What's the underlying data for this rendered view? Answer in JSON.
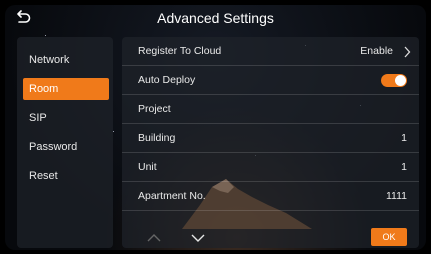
{
  "header": {
    "title": "Advanced Settings"
  },
  "sidebar": {
    "items": [
      {
        "label": "Network",
        "active": false
      },
      {
        "label": "Room",
        "active": true
      },
      {
        "label": "SIP",
        "active": false
      },
      {
        "label": "Password",
        "active": false
      },
      {
        "label": "Reset",
        "active": false
      }
    ]
  },
  "settings": {
    "register_to_cloud": {
      "label": "Register To Cloud",
      "value": "Enable"
    },
    "auto_deploy": {
      "label": "Auto Deploy",
      "enabled": true
    },
    "project": {
      "label": "Project",
      "value": ""
    },
    "building": {
      "label": "Building",
      "value": "1"
    },
    "unit": {
      "label": "Unit",
      "value": "1"
    },
    "apartment_no": {
      "label": "Apartment No.",
      "value": "1111"
    }
  },
  "footer": {
    "ok_label": "OK"
  },
  "colors": {
    "accent": "#f07a1a",
    "panel": "#1e222a"
  },
  "icons": {
    "back": "back-arrow-icon",
    "up": "chevron-up-icon",
    "down": "chevron-down-icon",
    "next": "chevron-right-icon"
  }
}
